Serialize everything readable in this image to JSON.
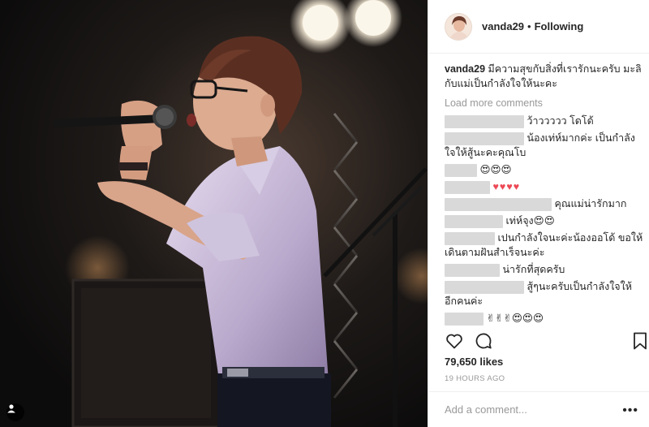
{
  "post": {
    "username": "vanda29",
    "follow_status": "Following",
    "separator": "•",
    "caption_user": "vanda29",
    "caption_text": "มีความสุขกับสิ่งที่เรารักนะครับ มะลิกับแม่เป็นกำลังใจให้นะคะ",
    "load_more": "Load more comments",
    "likes": "79,650 likes",
    "time_ago": "19 HOURS AGO",
    "add_comment_placeholder": "Add a comment...",
    "more_options": "•••"
  },
  "comments": [
    {
      "text": "ว้าววววว โดโด้"
    },
    {
      "text": "น้องเท่ห์มากค่ะ เป็นกำลังใจให้สู้นะคะคุณโบ"
    },
    {
      "text": "😍😍😍"
    },
    {
      "text": "♥♥♥♥"
    },
    {
      "text": "คุณแม่น่ารักมาก"
    },
    {
      "text": "เท่ห์จุง😍😍"
    },
    {
      "text": "เปนกำลังใจนะค่ะน้องออโด้ ขอให้เดินตามฝันสำเร็จนะค่ะ"
    },
    {
      "text": "น่ารักที่สุดครับ"
    },
    {
      "text": "สู้ๆนะครับเป็นกำลังใจให้อีกคนค่ะ"
    },
    {
      "text": "✌✌✌😍😍😍"
    }
  ],
  "icons": {
    "like": "heart-outline-icon",
    "comment": "speech-bubble-icon",
    "save": "bookmark-icon",
    "user_tag": "person-tag-icon"
  },
  "colors": {
    "text": "#262626",
    "muted": "#999999",
    "border": "#efefef",
    "heart_red": "#ed4956"
  }
}
